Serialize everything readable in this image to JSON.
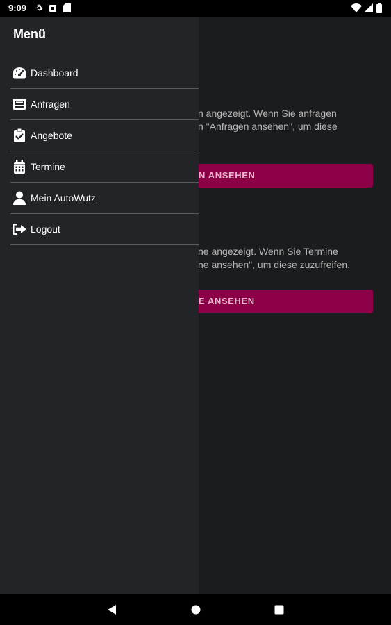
{
  "status_bar": {
    "time": "9:09",
    "icons": [
      "settings-icon",
      "notification-icon",
      "sim-card-icon",
      "wifi-icon",
      "signal-icon",
      "battery-icon"
    ]
  },
  "drawer": {
    "title": "Menü",
    "items": [
      {
        "label": "Dashboard",
        "icon": "dashboard-icon"
      },
      {
        "label": "Anfragen",
        "icon": "inbox-icon"
      },
      {
        "label": "Angebote",
        "icon": "clipboard-check-icon"
      },
      {
        "label": "Termine",
        "icon": "calendar-icon"
      },
      {
        "label": "Mein AutoWutz",
        "icon": "user-icon"
      },
      {
        "label": "Logout",
        "icon": "logout-icon"
      }
    ]
  },
  "content": {
    "section1": {
      "text_line1": "n angezeigt. Wenn Sie anfragen",
      "text_line2": "n \"Anfragen ansehen\", um diese",
      "button": "N ANSEHEN"
    },
    "section2": {
      "text_line1": "ne angezeigt. Wenn Sie Termine",
      "text_line2": "ne ansehen\", um diese zuzufreifen.",
      "button": "E ANSEHEN"
    }
  },
  "colors": {
    "accent": "#8c0047",
    "drawer_bg": "#232427",
    "app_bg": "#1b1c1e"
  },
  "nav_bar": {
    "buttons": [
      "back-icon",
      "home-icon",
      "recents-icon"
    ]
  }
}
